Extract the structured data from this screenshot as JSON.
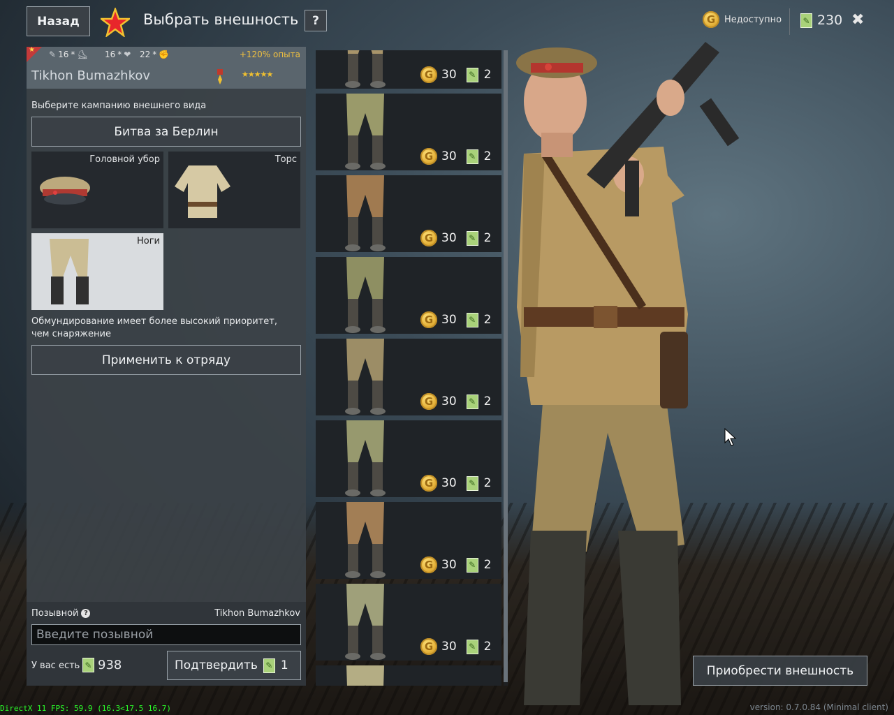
{
  "header": {
    "back_label": "Назад",
    "title": "Выбрать внешность",
    "help_label": "?",
    "gold_status": "Недоступно",
    "tickets": "230",
    "close_label": "✖"
  },
  "soldier": {
    "stats": [
      "16",
      "16",
      "22"
    ],
    "exp_bonus": "+120% опыта",
    "name": "Tikhon Bumazhkov",
    "stars": "★★★★★"
  },
  "appearance": {
    "campaign_label": "Выберите кампанию внешнего вида",
    "campaign_value": "Битва за Берлин",
    "slots": {
      "head": "Головной убор",
      "torso": "Торс",
      "legs": "Ноги"
    },
    "priority_note": "Обмундирование имеет более высокий приоритет, чем снаряжение",
    "apply_label": "Применить к отряду"
  },
  "callsign": {
    "label": "Позывной",
    "current": "Tikhon Bumazhkov",
    "placeholder": "Введите позывной",
    "you_have_label": "У вас есть",
    "you_have_count": "938",
    "confirm_label": "Подтвердить",
    "confirm_cost": "1"
  },
  "items": [
    {
      "gold": "30",
      "tickets": "2",
      "color": "#a8946a"
    },
    {
      "gold": "30",
      "tickets": "2",
      "color": "#9a9a6a"
    },
    {
      "gold": "30",
      "tickets": "2",
      "color": "#a07a50"
    },
    {
      "gold": "30",
      "tickets": "2",
      "color": "#8e8f62"
    },
    {
      "gold": "30",
      "tickets": "2",
      "color": "#9c8d66"
    },
    {
      "gold": "30",
      "tickets": "2",
      "color": "#97996e"
    },
    {
      "gold": "30",
      "tickets": "2",
      "color": "#a27e55"
    },
    {
      "gold": "30",
      "tickets": "2",
      "color": "#9fa07a"
    },
    {
      "gold": "",
      "tickets": "",
      "color": "#b4ad84"
    }
  ],
  "buy_label": "Приобрести внешность",
  "fps_text": "DirectX 11 FPS: 59.9 (16.3<17.5 16.7)",
  "version_text": "version: 0.7.0.84 (Minimal client)",
  "icons": {
    "coin": "gold-coin-icon",
    "ticket": "appearance-ticket-icon",
    "star": "red-star-icon"
  }
}
